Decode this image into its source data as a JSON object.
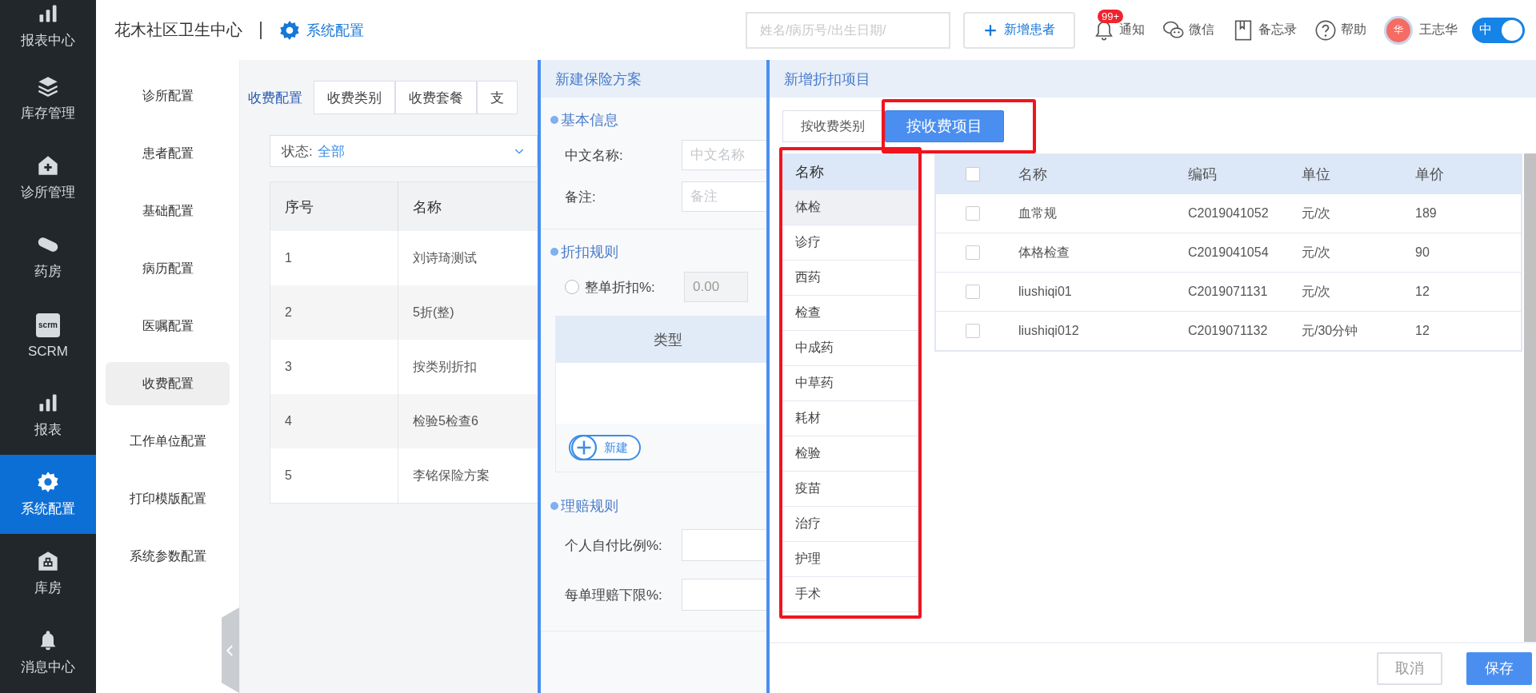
{
  "nav": {
    "items": [
      {
        "kind": "bars",
        "label": "报表中心",
        "selected": false
      },
      {
        "kind": "layers",
        "label": "库存管理",
        "selected": false
      },
      {
        "kind": "clinic",
        "label": "诊所管理",
        "selected": false
      },
      {
        "kind": "pill",
        "label": "药房",
        "selected": false
      },
      {
        "kind": "badge",
        "label": "SCRM",
        "icon_text": "scrm",
        "selected": false
      },
      {
        "kind": "bars",
        "label": "报表",
        "selected": false
      },
      {
        "kind": "gear",
        "label": "系统配置",
        "selected": true
      },
      {
        "kind": "warehouse",
        "label": "库房",
        "selected": false
      },
      {
        "kind": "bell",
        "label": "消息中心",
        "selected": false
      }
    ]
  },
  "header": {
    "title": "花木社区卫生中心",
    "module": "系统配置",
    "search": {
      "placeholder": "姓名/病历号/出生日期/"
    },
    "add_button": "新增患者",
    "tools": [
      {
        "kind": "bell",
        "label": "通知",
        "badge": "99+"
      },
      {
        "kind": "chat",
        "label": "微信"
      },
      {
        "kind": "book",
        "label": "备忘录"
      },
      {
        "kind": "help",
        "label": "帮助"
      }
    ],
    "user": {
      "avatar": "华",
      "name": "王志华"
    },
    "language_toggle": {
      "label": "中",
      "on": true
    }
  },
  "submenu": {
    "items": [
      {
        "label": "诊所配置",
        "selected": false
      },
      {
        "label": "患者配置",
        "selected": false
      },
      {
        "label": "基础配置",
        "selected": false
      },
      {
        "label": "病历配置",
        "selected": false
      },
      {
        "label": "医嘱配置",
        "selected": false
      },
      {
        "label": "收费配置",
        "selected": true
      },
      {
        "label": "工作单位配置",
        "selected": false
      },
      {
        "label": "打印模版配置",
        "selected": false
      },
      {
        "label": "系统参数配置",
        "selected": false
      }
    ]
  },
  "content": {
    "tabs": [
      {
        "label": "收费配置",
        "selected": true
      },
      {
        "label": "收费类别",
        "selected": false
      },
      {
        "label": "收费套餐",
        "selected": false
      },
      {
        "label": "支",
        "selected": false
      }
    ],
    "status_filter": {
      "label": "状态:",
      "value": "全部"
    },
    "table": {
      "columns": [
        "序号",
        "名称"
      ],
      "rows": [
        [
          "1",
          "刘诗琦测试"
        ],
        [
          "2",
          "5折(整)"
        ],
        [
          "3",
          "按类别折扣"
        ],
        [
          "4",
          "检验5检查6"
        ],
        [
          "5",
          "李铭保险方案"
        ]
      ]
    }
  },
  "insurance_panel": {
    "title": "新建保险方案",
    "basic_info": {
      "heading": "基本信息",
      "fields": [
        {
          "label": "中文名称:",
          "placeholder": "中文名称"
        },
        {
          "label": "备注:",
          "placeholder": "备注"
        }
      ]
    },
    "discount_rules": {
      "heading": "折扣规则",
      "whole_order": {
        "label": "整单折扣%:",
        "checked": false,
        "value": "0.00",
        "disabled": true
      },
      "type_table": {
        "columns": [
          "类型"
        ]
      },
      "new_button": "新建"
    },
    "claim_rules": {
      "heading": "理赔规则",
      "fields": [
        {
          "label": "个人自付比例%:"
        },
        {
          "label": "每单理赔下限%:"
        }
      ]
    }
  },
  "discount_panel": {
    "title": "新增折扣项目",
    "tabs": [
      {
        "label": "按收费类别",
        "selected": false,
        "highlighted": false
      },
      {
        "label": "按收费项目",
        "selected": true,
        "highlighted": true
      }
    ],
    "categories": {
      "column": "名称",
      "highlighted": true,
      "items": [
        {
          "label": "体检",
          "selected": true
        },
        {
          "label": "诊疗",
          "selected": false
        },
        {
          "label": "西药",
          "selected": false
        },
        {
          "label": "检查",
          "selected": false
        },
        {
          "label": "中成药",
          "selected": false
        },
        {
          "label": "中草药",
          "selected": false
        },
        {
          "label": "耗材",
          "selected": false
        },
        {
          "label": "检验",
          "selected": false
        },
        {
          "label": "疫苗",
          "selected": false
        },
        {
          "label": "治疗",
          "selected": false
        },
        {
          "label": "护理",
          "selected": false
        },
        {
          "label": "手术",
          "selected": false
        }
      ]
    },
    "items_table": {
      "all_checked": false,
      "columns": [
        "名称",
        "编码",
        "单位",
        "单价"
      ],
      "rows": [
        {
          "checked": false,
          "cells": [
            "血常规",
            "C2019041052",
            "元/次",
            "189"
          ]
        },
        {
          "checked": false,
          "cells": [
            "体格检查",
            "C2019041054",
            "元/次",
            "90"
          ]
        },
        {
          "checked": false,
          "cells": [
            "liushiqi01",
            "C2019071131",
            "元/次",
            "12"
          ]
        },
        {
          "checked": false,
          "cells": [
            "liushiqi012",
            "C2019071132",
            "元/30分钟",
            "12"
          ]
        }
      ]
    },
    "buttons": [
      {
        "label": "取消",
        "kind": "secondary"
      },
      {
        "label": "保存",
        "kind": "primary"
      }
    ]
  }
}
